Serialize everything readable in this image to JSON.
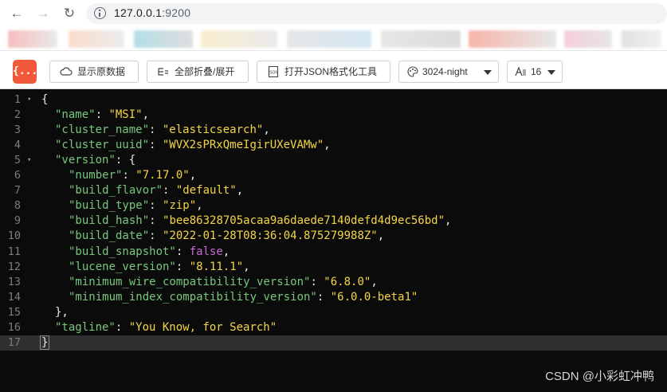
{
  "browser": {
    "url_host": "127.0.0.1",
    "url_port": ":9200"
  },
  "toolbar": {
    "logo_text": "{...}",
    "show_raw_label": "显示原数据",
    "collapse_expand_label": "全部折叠/展开",
    "open_json_tool_label": "打开JSON格式化工具",
    "theme_value": "3024-night",
    "font_size_value": "16"
  },
  "json_lines": [
    {
      "n": "1",
      "fold": true,
      "parts": [
        [
          "p",
          "{"
        ]
      ]
    },
    {
      "n": "2",
      "indent": 1,
      "parts": [
        [
          "k",
          "\"name\""
        ],
        [
          "p",
          ": "
        ],
        [
          "s",
          "\"MSI\""
        ],
        [
          "p",
          ","
        ]
      ]
    },
    {
      "n": "3",
      "indent": 1,
      "parts": [
        [
          "k",
          "\"cluster_name\""
        ],
        [
          "p",
          ": "
        ],
        [
          "s",
          "\"elasticsearch\""
        ],
        [
          "p",
          ","
        ]
      ]
    },
    {
      "n": "4",
      "indent": 1,
      "parts": [
        [
          "k",
          "\"cluster_uuid\""
        ],
        [
          "p",
          ": "
        ],
        [
          "s",
          "\"WVX2sPRxQmeIgirUXeVAMw\""
        ],
        [
          "p",
          ","
        ]
      ]
    },
    {
      "n": "5",
      "indent": 1,
      "fold": true,
      "parts": [
        [
          "k",
          "\"version\""
        ],
        [
          "p",
          ": {"
        ]
      ]
    },
    {
      "n": "6",
      "indent": 2,
      "parts": [
        [
          "k",
          "\"number\""
        ],
        [
          "p",
          ": "
        ],
        [
          "s",
          "\"7.17.0\""
        ],
        [
          "p",
          ","
        ]
      ]
    },
    {
      "n": "7",
      "indent": 2,
      "parts": [
        [
          "k",
          "\"build_flavor\""
        ],
        [
          "p",
          ": "
        ],
        [
          "s",
          "\"default\""
        ],
        [
          "p",
          ","
        ]
      ]
    },
    {
      "n": "8",
      "indent": 2,
      "parts": [
        [
          "k",
          "\"build_type\""
        ],
        [
          "p",
          ": "
        ],
        [
          "s",
          "\"zip\""
        ],
        [
          "p",
          ","
        ]
      ]
    },
    {
      "n": "9",
      "indent": 2,
      "parts": [
        [
          "k",
          "\"build_hash\""
        ],
        [
          "p",
          ": "
        ],
        [
          "s",
          "\"bee86328705acaa9a6daede7140defd4d9ec56bd\""
        ],
        [
          "p",
          ","
        ]
      ]
    },
    {
      "n": "10",
      "indent": 2,
      "parts": [
        [
          "k",
          "\"build_date\""
        ],
        [
          "p",
          ": "
        ],
        [
          "s",
          "\"2022-01-28T08:36:04.875279988Z\""
        ],
        [
          "p",
          ","
        ]
      ]
    },
    {
      "n": "11",
      "indent": 2,
      "parts": [
        [
          "k",
          "\"build_snapshot\""
        ],
        [
          "p",
          ": "
        ],
        [
          "b",
          "false"
        ],
        [
          "p",
          ","
        ]
      ]
    },
    {
      "n": "12",
      "indent": 2,
      "parts": [
        [
          "k",
          "\"lucene_version\""
        ],
        [
          "p",
          ": "
        ],
        [
          "s",
          "\"8.11.1\""
        ],
        [
          "p",
          ","
        ]
      ]
    },
    {
      "n": "13",
      "indent": 2,
      "parts": [
        [
          "k",
          "\"minimum_wire_compatibility_version\""
        ],
        [
          "p",
          ": "
        ],
        [
          "s",
          "\"6.8.0\""
        ],
        [
          "p",
          ","
        ]
      ]
    },
    {
      "n": "14",
      "indent": 2,
      "parts": [
        [
          "k",
          "\"minimum_index_compatibility_version\""
        ],
        [
          "p",
          ": "
        ],
        [
          "s",
          "\"6.0.0-beta1\""
        ]
      ]
    },
    {
      "n": "15",
      "indent": 1,
      "parts": [
        [
          "p",
          "},"
        ]
      ]
    },
    {
      "n": "16",
      "indent": 1,
      "parts": [
        [
          "k",
          "\"tagline\""
        ],
        [
          "p",
          ": "
        ],
        [
          "s",
          "\"You Know, for Search\""
        ]
      ]
    },
    {
      "n": "17",
      "active": true,
      "parts": [
        [
          "p",
          "}"
        ]
      ]
    }
  ],
  "watermark": "CSDN @小彩虹冲鸭",
  "colors": {
    "key": "#78c87c",
    "string": "#f5d547",
    "boolean": "#c96bd9",
    "logo": "#f2593a",
    "background": "#0b0b0b"
  }
}
